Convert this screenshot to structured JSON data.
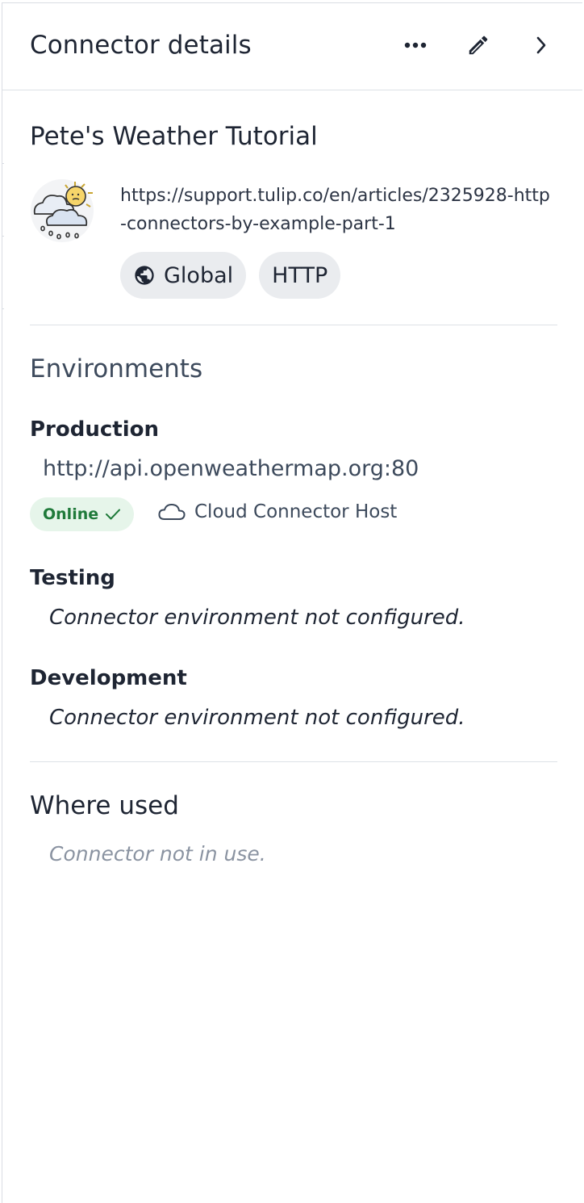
{
  "header": {
    "title": "Connector details",
    "more_icon": "more-horizontal-icon",
    "edit_icon": "pencil-icon",
    "collapse_icon": "chevron-right-icon"
  },
  "connector": {
    "name": "Pete's Weather Tutorial",
    "avatar_icon": "weather-cloud-sun-rain-icon",
    "link": "https://support.tulip.co/en/articles/2325928-http-connectors-by-example-part-1",
    "chips": [
      {
        "label": "Global",
        "icon": "globe-icon"
      },
      {
        "label": "HTTP"
      }
    ]
  },
  "environments": {
    "title": "Environments",
    "production": {
      "name": "Production",
      "url": "http://api.openweathermap.org:80",
      "status": "Online",
      "status_icon": "check-icon",
      "host": "Cloud Connector Host",
      "host_icon": "cloud-icon"
    },
    "testing": {
      "name": "Testing",
      "message": "Connector environment not configured."
    },
    "development": {
      "name": "Development",
      "message": "Connector environment not configured."
    }
  },
  "where_used": {
    "title": "Where used",
    "message": "Connector not in use."
  },
  "colors": {
    "status_bg": "#e6f5ea",
    "status_text": "#1f7a3a",
    "chip_bg": "#eaecef",
    "divider": "#dde1e6"
  }
}
